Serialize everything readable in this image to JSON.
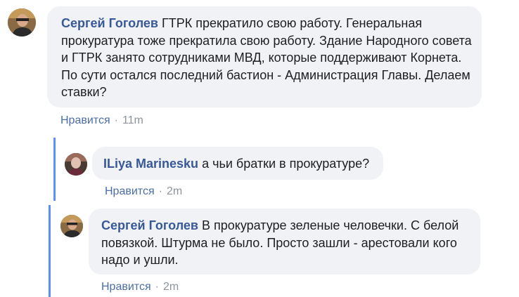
{
  "comments": [
    {
      "author": "Сергей Гоголев",
      "text": "ГТРК прекратило свою работу. Генеральная прокуратура тоже прекратила свою работу. Здание Народного совета и ГТРК занято сотрудниками МВД, которые поддерживают Корнета. По сути остался последний бастион - Администрация Главы. Делаем ставки?",
      "like_label": "Нравится",
      "separator": "·",
      "time": "11m"
    },
    {
      "author": "ILiya Marinesku",
      "text": "а чьи братки в прокуратуре?",
      "like_label": "Нравится",
      "separator": "·",
      "time": "2m"
    },
    {
      "author": "Сергей Гоголев",
      "text": "В прокуратуре зеленые человечки. С белой повязкой. Штурма не было. Просто зашли - арестовали кого надо и ушли.",
      "like_label": "Нравится",
      "separator": "·",
      "time": "2m"
    }
  ],
  "colors": {
    "bubble": "#f0f2f5",
    "author": "#385898",
    "thread_line": "#5890ff",
    "meta": "#65676b"
  }
}
